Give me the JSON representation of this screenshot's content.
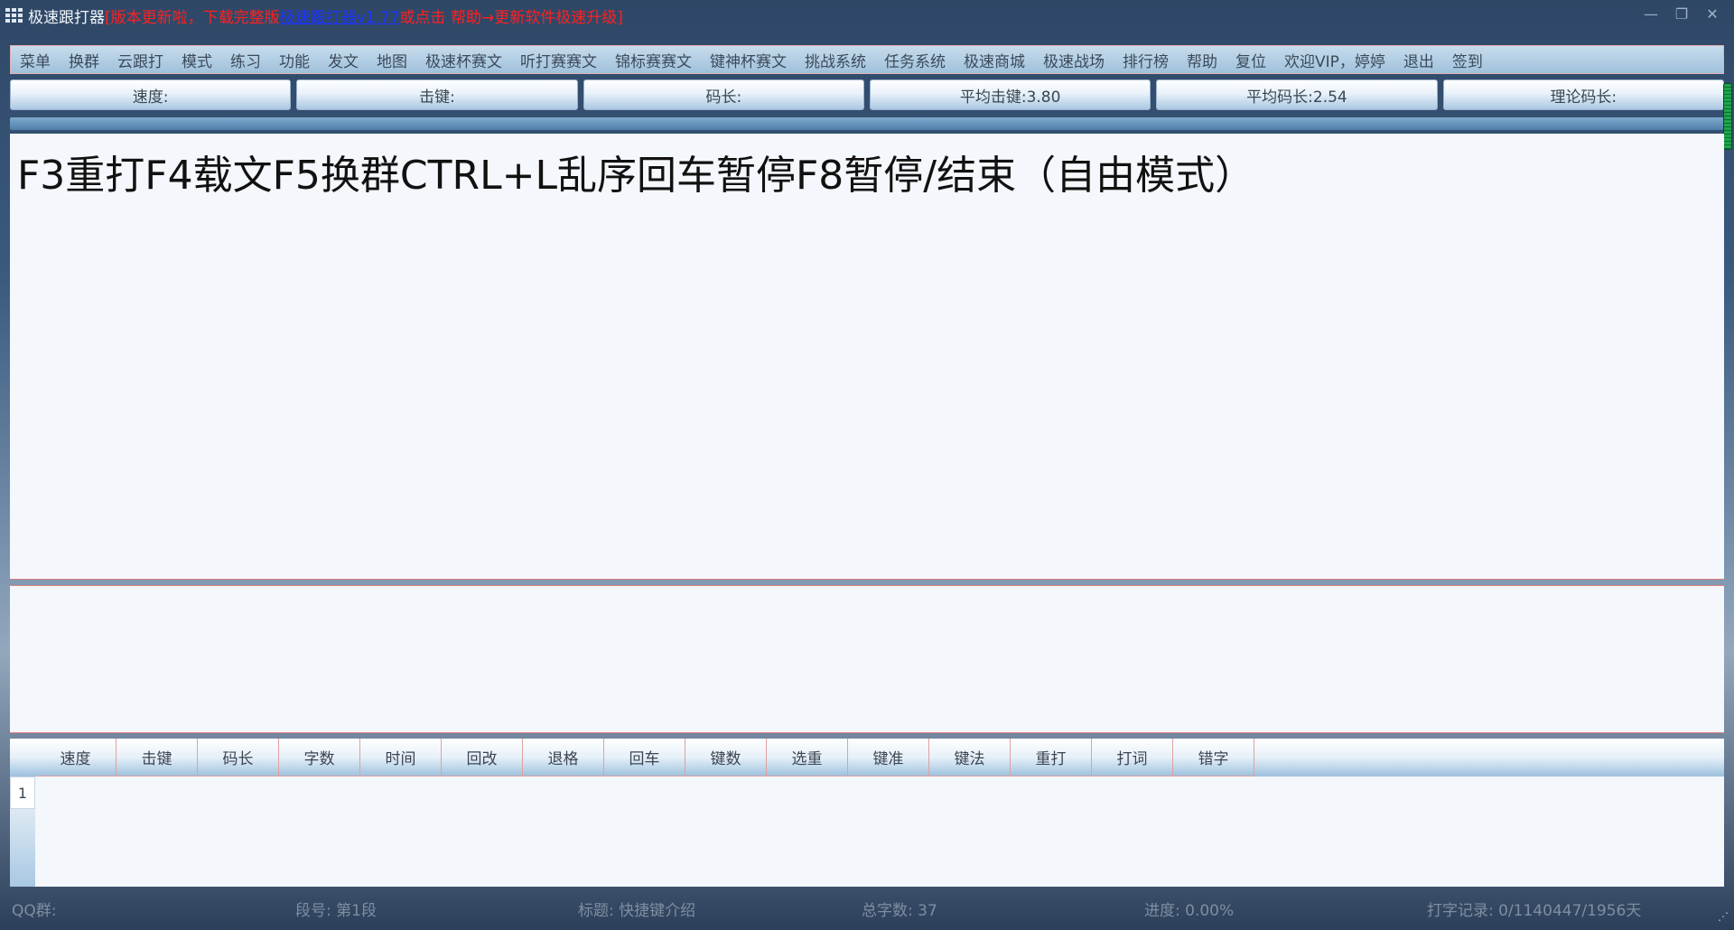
{
  "titlebar": {
    "app_name": "极速跟打器",
    "notice_prefix": "[版本更新啦，下载完整版 ",
    "link_text": "极速跟打器v1.77",
    "notice_suffix": " 或点击 帮助→更新软件极速升级]"
  },
  "window_controls": {
    "minimize": "—",
    "restore": "❐",
    "close": "✕"
  },
  "menu": [
    "菜单",
    "换群",
    "云跟打",
    "模式",
    "练习",
    "功能",
    "发文",
    "地图",
    "极速杯赛文",
    "听打赛赛文",
    "锦标赛赛文",
    "键神杯赛文",
    "挑战系统",
    "任务系统",
    "极速商城",
    "极速战场",
    "排行榜",
    "帮助",
    "复位",
    "欢迎VIP，婷婷",
    "退出",
    "签到"
  ],
  "stats": {
    "speed": "速度:",
    "keystroke": "击键:",
    "code_length": "码长:",
    "avg_keystroke": "平均击键:3.80",
    "avg_code_length": "平均码长:2.54",
    "theory_code_length": "理论码长:"
  },
  "text_display": "F3重打F4载文F5换群CTRL+L乱序回车暂停F8暂停/结束（自由模式）",
  "grid": {
    "headers": [
      "速度",
      "击键",
      "码长",
      "字数",
      "时间",
      "回改",
      "退格",
      "回车",
      "键数",
      "选重",
      "键准",
      "键法",
      "重打",
      "打词",
      "错字"
    ],
    "row_number": "1"
  },
  "statusbar": {
    "qq_group": "QQ群:",
    "segment": "段号: 第1段",
    "title": "标题: 快捷键介绍",
    "total_chars": "总字数: 37",
    "progress": "进度: 0.00%",
    "record": "打字记录: 0/1140447/1956天"
  }
}
